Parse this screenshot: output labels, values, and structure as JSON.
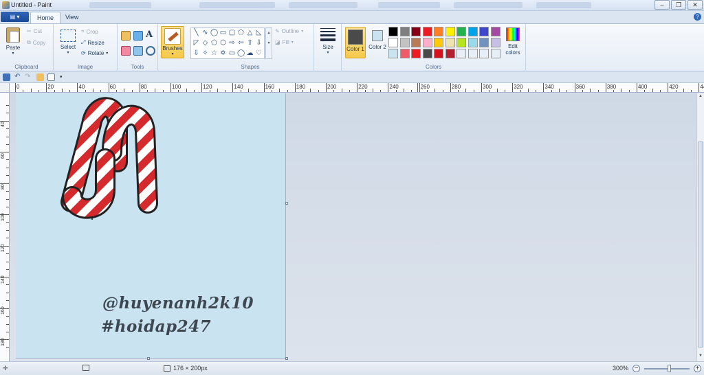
{
  "window": {
    "title": "Untitled - Paint"
  },
  "tabs": [
    "Home",
    "View"
  ],
  "clipboard": {
    "paste": "Paste",
    "cut": "Cut",
    "copy": "Copy",
    "group": "Clipboard"
  },
  "image": {
    "select": "Select",
    "crop": "Crop",
    "resize": "Resize",
    "rotate": "Rotate",
    "group": "Image"
  },
  "tools": {
    "group": "Tools",
    "text_glyph": "A"
  },
  "brushes": {
    "label": "Brushes"
  },
  "shapes": {
    "group": "Shapes",
    "outline": "Outline",
    "fill": "Fill"
  },
  "size": {
    "label": "Size"
  },
  "colors": {
    "group": "Colors",
    "color1_label": "Color 1",
    "color2_label": "Color 2",
    "edit_label": "Edit colors",
    "color1": "#4a4a4a",
    "color2": "#c9e3f1",
    "palette": [
      "#000000",
      "#7f7f7f",
      "#880015",
      "#ed1c24",
      "#ff7f27",
      "#fff200",
      "#22b14c",
      "#00a2e8",
      "#3f48cc",
      "#a349a4",
      "#ffffff",
      "#c3c3c3",
      "#b97a57",
      "#ffaec9",
      "#ffc90e",
      "#efe4b0",
      "#b5e61d",
      "#99d9ea",
      "#7092be",
      "#c8bfe7",
      "#c9e3f1",
      "#ef5b68",
      "#ed1c24",
      "#4a4a4a",
      "#d4121f",
      "#b32030",
      "#e8eef5",
      "#e8eef5",
      "#e8eef5",
      "#e8eef5"
    ]
  },
  "ruler": {
    "h_labels": [
      "0",
      "20",
      "40",
      "60",
      "80",
      "100",
      "120",
      "140",
      "160",
      "180",
      "200",
      "220",
      "240",
      "260",
      "280",
      "300",
      "320",
      "340",
      "360",
      "380",
      "400",
      "420",
      "440"
    ],
    "v_labels": [
      "40",
      "60",
      "80",
      "100",
      "120",
      "140",
      "160",
      "180"
    ]
  },
  "canvas": {
    "watermark_line1": "@huyenanh2k10",
    "watermark_line2": "#hoidap247"
  },
  "status": {
    "dimensions": "176 × 200px",
    "zoom": "300%",
    "zoom_level": 0.55
  }
}
